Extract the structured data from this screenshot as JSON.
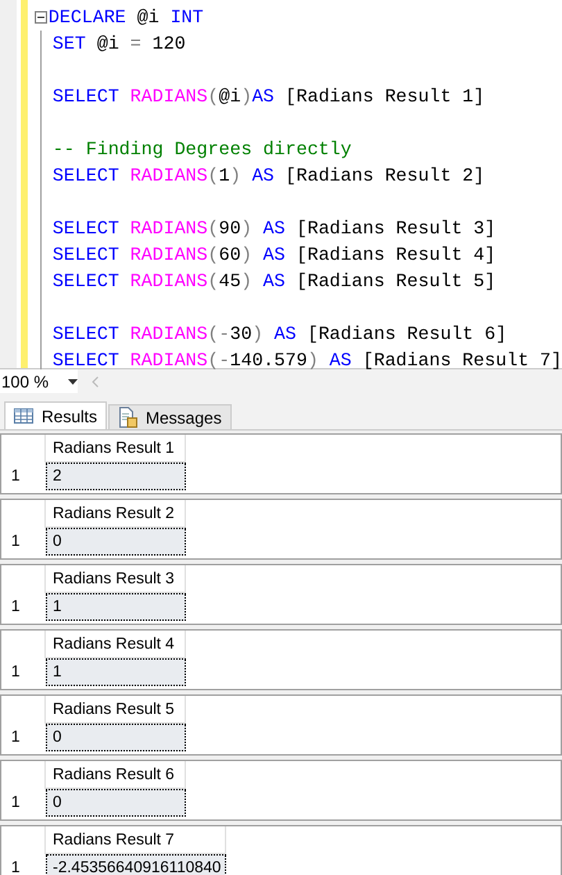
{
  "editor": {
    "blocks": [
      [
        [
          {
            "kind": "keyword",
            "text": "DECLARE"
          },
          {
            "kind": "text",
            "text": "@i",
            "space": true
          },
          {
            "kind": "keyword",
            "text": "INT",
            "space": true
          }
        ],
        [
          {
            "kind": "keyword",
            "text": "SET"
          },
          {
            "kind": "text",
            "text": "@i",
            "space": true
          },
          {
            "kind": "punct",
            "text": "=",
            "space": true
          },
          {
            "kind": "text",
            "text": "120",
            "space": true
          }
        ]
      ],
      [
        [
          {
            "kind": "keyword",
            "text": "SELECT"
          },
          {
            "kind": "function",
            "text": "RADIANS",
            "space": true
          },
          {
            "kind": "punct",
            "text": "("
          },
          {
            "kind": "text",
            "text": "@i"
          },
          {
            "kind": "punct",
            "text": ")"
          },
          {
            "kind": "keyword",
            "text": "AS"
          },
          {
            "kind": "text",
            "text": "[Radians Result 1]",
            "space": true
          }
        ]
      ],
      [
        [
          {
            "kind": "comment",
            "text": "-- Finding Degrees directly"
          }
        ],
        [
          {
            "kind": "keyword",
            "text": "SELECT"
          },
          {
            "kind": "function",
            "text": "RADIANS",
            "space": true
          },
          {
            "kind": "punct",
            "text": "("
          },
          {
            "kind": "text",
            "text": "1"
          },
          {
            "kind": "punct",
            "text": ")"
          },
          {
            "kind": "keyword",
            "text": "AS",
            "space": true
          },
          {
            "kind": "text",
            "text": "[Radians Result 2]",
            "space": true
          }
        ]
      ],
      [
        [
          {
            "kind": "keyword",
            "text": "SELECT"
          },
          {
            "kind": "function",
            "text": "RADIANS",
            "space": true
          },
          {
            "kind": "punct",
            "text": "("
          },
          {
            "kind": "text",
            "text": "90"
          },
          {
            "kind": "punct",
            "text": ")"
          },
          {
            "kind": "keyword",
            "text": "AS",
            "space": true
          },
          {
            "kind": "text",
            "text": "[Radians Result 3]",
            "space": true
          }
        ],
        [
          {
            "kind": "keyword",
            "text": "SELECT"
          },
          {
            "kind": "function",
            "text": "RADIANS",
            "space": true
          },
          {
            "kind": "punct",
            "text": "("
          },
          {
            "kind": "text",
            "text": "60"
          },
          {
            "kind": "punct",
            "text": ")"
          },
          {
            "kind": "keyword",
            "text": "AS",
            "space": true
          },
          {
            "kind": "text",
            "text": "[Radians Result 4]",
            "space": true
          }
        ],
        [
          {
            "kind": "keyword",
            "text": "SELECT"
          },
          {
            "kind": "function",
            "text": "RADIANS",
            "space": true
          },
          {
            "kind": "punct",
            "text": "("
          },
          {
            "kind": "text",
            "text": "45"
          },
          {
            "kind": "punct",
            "text": ")"
          },
          {
            "kind": "keyword",
            "text": "AS",
            "space": true
          },
          {
            "kind": "text",
            "text": "[Radians Result 5]",
            "space": true
          }
        ]
      ],
      [
        [
          {
            "kind": "keyword",
            "text": "SELECT"
          },
          {
            "kind": "function",
            "text": "RADIANS",
            "space": true
          },
          {
            "kind": "punct",
            "text": "(-"
          },
          {
            "kind": "text",
            "text": "30"
          },
          {
            "kind": "punct",
            "text": ")"
          },
          {
            "kind": "keyword",
            "text": "AS",
            "space": true
          },
          {
            "kind": "text",
            "text": "[Radians Result 6]",
            "space": true
          }
        ],
        [
          {
            "kind": "keyword",
            "text": "SELECT"
          },
          {
            "kind": "function",
            "text": "RADIANS",
            "space": true
          },
          {
            "kind": "punct",
            "text": "(-"
          },
          {
            "kind": "text",
            "text": "140.579"
          },
          {
            "kind": "punct",
            "text": ")"
          },
          {
            "kind": "keyword",
            "text": "AS",
            "space": true
          },
          {
            "kind": "text",
            "text": "[Radians Result 7]",
            "space": true
          }
        ]
      ]
    ]
  },
  "zoom": "100 %",
  "tabs": [
    {
      "label": "Results",
      "selected": true
    },
    {
      "label": "Messages",
      "selected": false
    }
  ],
  "results": [
    {
      "column": "Radians Result 1",
      "rows": [
        {
          "number": "1",
          "value": "2"
        }
      ]
    },
    {
      "column": "Radians Result 2",
      "rows": [
        {
          "number": "1",
          "value": "0"
        }
      ]
    },
    {
      "column": "Radians Result 3",
      "rows": [
        {
          "number": "1",
          "value": "1"
        }
      ]
    },
    {
      "column": "Radians Result 4",
      "rows": [
        {
          "number": "1",
          "value": "1"
        }
      ]
    },
    {
      "column": "Radians Result 5",
      "rows": [
        {
          "number": "1",
          "value": "0"
        }
      ]
    },
    {
      "column": "Radians Result 6",
      "rows": [
        {
          "number": "1",
          "value": "0"
        }
      ]
    },
    {
      "column": "Radians Result 7",
      "rows": [
        {
          "number": "1",
          "value": "-2.45356640916110840"
        }
      ]
    }
  ]
}
